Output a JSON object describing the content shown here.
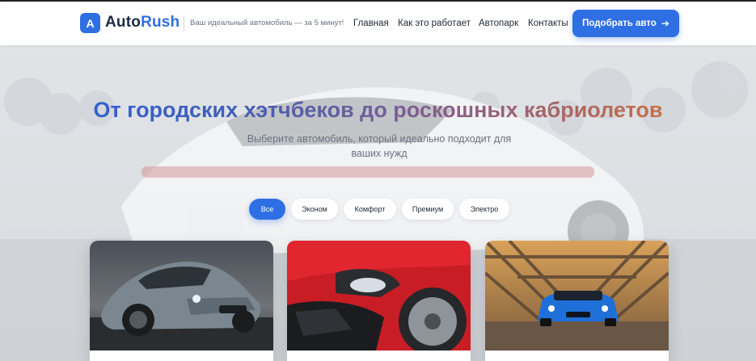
{
  "header": {
    "logo_letter": "A",
    "brand_part1": "Auto",
    "brand_part2": "Rush",
    "tagline": "Ваш идеальный автомобиль — за 5 минут!",
    "nav": [
      "Главная",
      "Как это работает",
      "Автопарк",
      "Контакты"
    ],
    "cta_label": "Подобрать авто",
    "cta_icon": "arrow-right-icon"
  },
  "hero": {
    "title": "От городских хэтчбеков до роскошных кабриолетов",
    "subtitle": "Выберите автомобиль, который идеально подходит для ваших нужд"
  },
  "filters": [
    "Все",
    "Эконом",
    "Комфорт",
    "Премиум",
    "Электро"
  ],
  "active_filter": "Все",
  "cards": [
    {
      "image": "grey-sports-coupe-photo"
    },
    {
      "image": "red-hatchback-front-photo"
    },
    {
      "image": "blue-car-on-bridge-photo"
    }
  ],
  "colors": {
    "accent": "#2f6fe4",
    "title_gradient_start": "#2f62d8",
    "title_gradient_end": "#e0762c"
  }
}
